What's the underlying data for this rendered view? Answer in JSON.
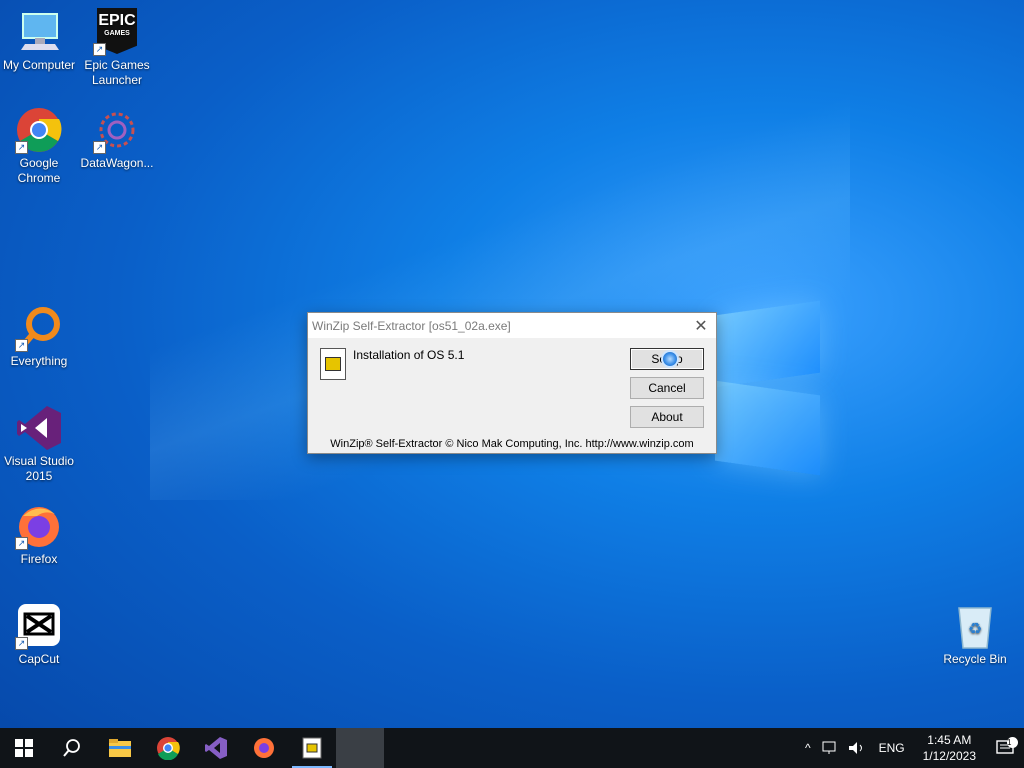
{
  "desktop": {
    "icons": [
      {
        "label": "My Computer"
      },
      {
        "label": "Epic Games Launcher"
      },
      {
        "label": "Google Chrome"
      },
      {
        "label": "DataWagon..."
      },
      {
        "label": "Everything"
      },
      {
        "label": "Visual Studio 2015"
      },
      {
        "label": "Firefox"
      },
      {
        "label": "CapCut"
      },
      {
        "label": "Recycle Bin"
      }
    ],
    "epic_text": "EPIC",
    "epic_sub": "GAMES"
  },
  "dialog": {
    "title": "WinZip Self-Extractor [os51_02a.exe]",
    "message": "Installation of OS 5.1",
    "setup_label": "Setup",
    "cancel_label": "Cancel",
    "about_label": "About",
    "footer": "WinZip® Self-Extractor  © Nico Mak Computing, Inc.  http://www.winzip.com"
  },
  "taskbar": {
    "language": "ENG",
    "time": "1:45 AM",
    "date": "1/12/2023",
    "notification_count": "1"
  },
  "colors": {
    "accent": "#0a5fc8",
    "taskbar": "#101418"
  }
}
